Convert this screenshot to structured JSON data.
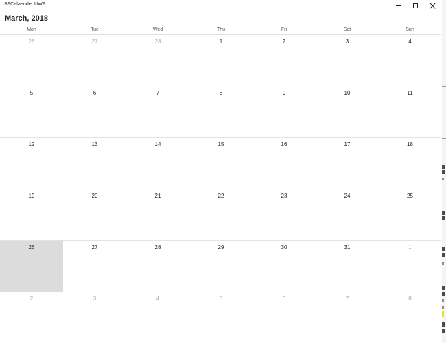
{
  "window": {
    "title": "SFCalaender.UWP"
  },
  "calendar": {
    "month_header": "March, 2018",
    "weekdays": [
      "Mon",
      "Tue",
      "Wed",
      "Thu",
      "Fri",
      "Sat",
      "Sun"
    ],
    "weeks": [
      [
        {
          "d": "26",
          "o": true
        },
        {
          "d": "27",
          "o": true
        },
        {
          "d": "28",
          "o": true
        },
        {
          "d": "1",
          "o": false
        },
        {
          "d": "2",
          "o": false
        },
        {
          "d": "3",
          "o": false
        },
        {
          "d": "4",
          "o": false
        }
      ],
      [
        {
          "d": "5",
          "o": false
        },
        {
          "d": "6",
          "o": false
        },
        {
          "d": "7",
          "o": false
        },
        {
          "d": "8",
          "o": false
        },
        {
          "d": "9",
          "o": false
        },
        {
          "d": "10",
          "o": false
        },
        {
          "d": "11",
          "o": false
        }
      ],
      [
        {
          "d": "12",
          "o": false
        },
        {
          "d": "13",
          "o": false
        },
        {
          "d": "14",
          "o": false
        },
        {
          "d": "15",
          "o": false
        },
        {
          "d": "16",
          "o": false
        },
        {
          "d": "17",
          "o": false
        },
        {
          "d": "18",
          "o": false
        }
      ],
      [
        {
          "d": "19",
          "o": false
        },
        {
          "d": "20",
          "o": false
        },
        {
          "d": "21",
          "o": false
        },
        {
          "d": "22",
          "o": false
        },
        {
          "d": "23",
          "o": false
        },
        {
          "d": "24",
          "o": false
        },
        {
          "d": "25",
          "o": false
        }
      ],
      [
        {
          "d": "26",
          "o": false,
          "selected": true
        },
        {
          "d": "27",
          "o": false
        },
        {
          "d": "28",
          "o": false
        },
        {
          "d": "29",
          "o": false
        },
        {
          "d": "30",
          "o": false
        },
        {
          "d": "31",
          "o": false
        },
        {
          "d": "1",
          "o": true
        }
      ],
      [
        {
          "d": "2",
          "o": true
        },
        {
          "d": "3",
          "o": true
        },
        {
          "d": "4",
          "o": true
        },
        {
          "d": "5",
          "o": true
        },
        {
          "d": "6",
          "o": true
        },
        {
          "d": "7",
          "o": true
        },
        {
          "d": "8",
          "o": true
        }
      ]
    ]
  },
  "colors": {
    "selected_day_background": "#dcdcdc",
    "other_month_text": "#a8a8a8"
  }
}
